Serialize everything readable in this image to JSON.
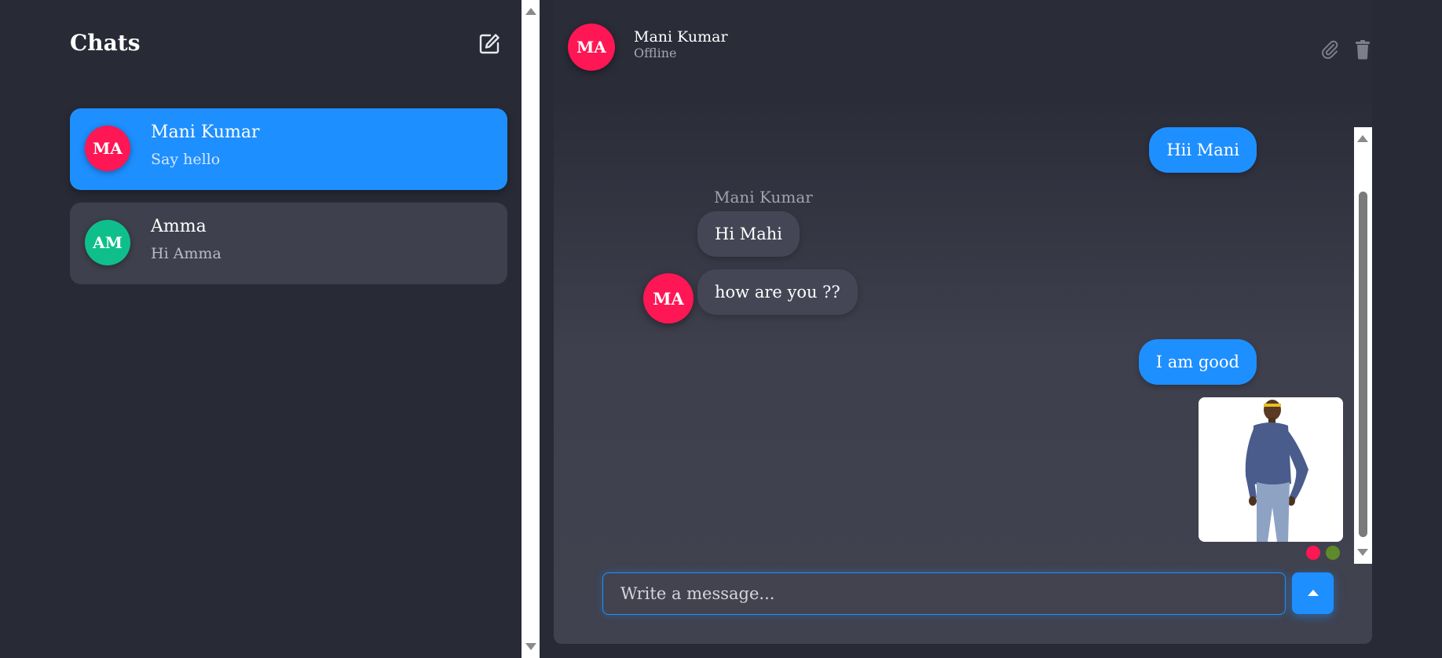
{
  "sidebar": {
    "title": "Chats",
    "chats": [
      {
        "initials": "MA",
        "name": "Mani Kumar",
        "preview": "Say hello",
        "avatar_color": "#ff1654",
        "active": true
      },
      {
        "initials": "AM",
        "name": "Amma",
        "preview": "Hi Amma",
        "avatar_color": "#0fbf8b",
        "active": false
      }
    ]
  },
  "chat": {
    "header": {
      "initials": "MA",
      "name": "Mani Kumar",
      "status": "Offline"
    },
    "messages": [
      {
        "direction": "out",
        "text": "Hii Mani"
      },
      {
        "direction": "in",
        "sender": "Mani Kumar",
        "text": "Hi Mahi"
      },
      {
        "direction": "in",
        "text": "how are you ??",
        "avatar": "MA"
      },
      {
        "direction": "out",
        "text": "I am good"
      },
      {
        "direction": "out",
        "type": "image"
      }
    ],
    "composer": {
      "placeholder": "Write a message..."
    }
  },
  "colors": {
    "accent": "#1e8fff",
    "avatar_red": "#ff1654",
    "avatar_green": "#0fbf8b",
    "reaction_red": "#ff1654",
    "reaction_green": "#5e8a2a",
    "background": "#282a36",
    "panel": "#3f404d"
  },
  "icons": {
    "compose": "edit-icon",
    "attach": "paperclip-icon",
    "delete": "trash-icon",
    "send": "send-icon"
  }
}
